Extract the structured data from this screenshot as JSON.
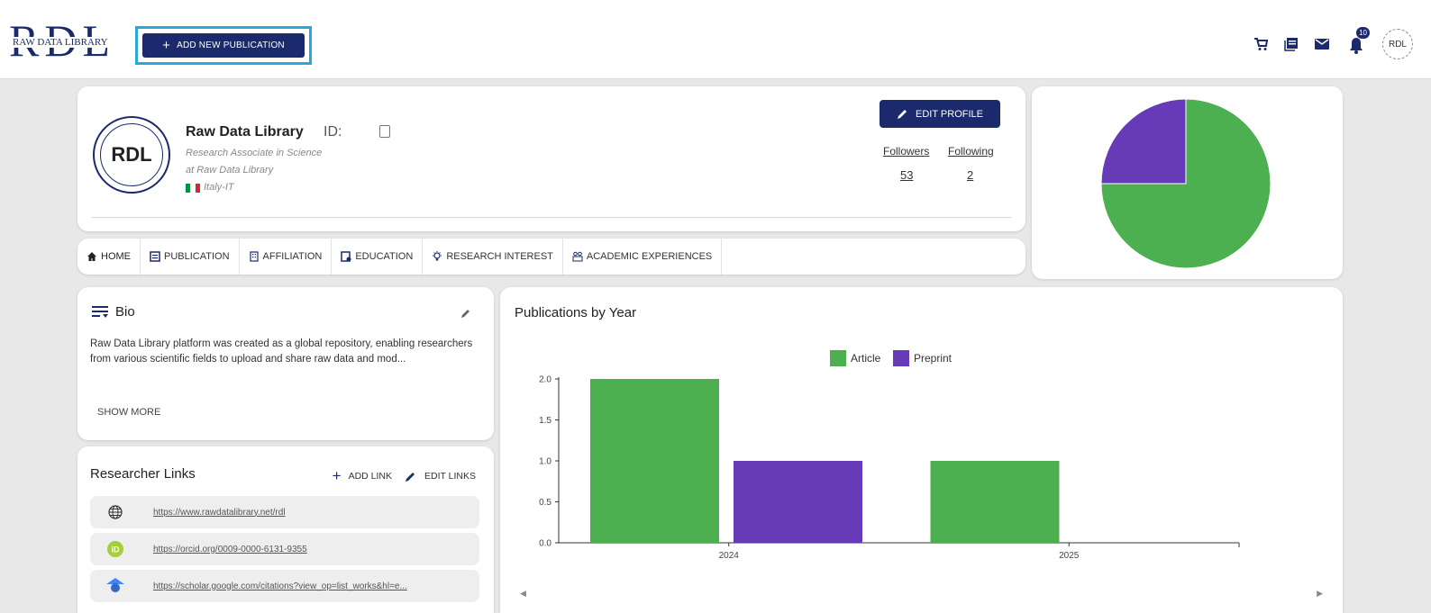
{
  "header": {
    "logo_letters": "RDL",
    "logo_subtitle": "RAW DATA LIBRARY",
    "add_publication_label": "ADD NEW PUBLICATION",
    "notification_count": "10",
    "avatar_text": "RDL",
    "icons": [
      "cart-icon",
      "library-icon",
      "mail-icon",
      "bell-icon"
    ]
  },
  "profile": {
    "avatar_text": "RDL",
    "name": "Raw Data Library",
    "id_label": "ID:",
    "role": "Research Associate in Science",
    "affiliation": "at Raw Data Library",
    "country": "Italy-IT",
    "edit_label": "EDIT PROFILE",
    "followers_label": "Followers",
    "followers_count": "53",
    "following_label": "Following",
    "following_count": "2"
  },
  "tabs": [
    {
      "label": "HOME",
      "icon": "home-icon"
    },
    {
      "label": "PUBLICATION",
      "icon": "publication-icon"
    },
    {
      "label": "AFFILIATION",
      "icon": "building-icon"
    },
    {
      "label": "EDUCATION",
      "icon": "education-icon"
    },
    {
      "label": "RESEARCH INTEREST",
      "icon": "lightbulb-icon"
    },
    {
      "label": "ACADEMIC EXPERIENCES",
      "icon": "group-icon"
    }
  ],
  "bio": {
    "title": "Bio",
    "text": "Raw Data Library platform was created as a global repository, enabling researchers from various scientific fields to upload and share raw data and mod...",
    "show_more": "SHOW MORE"
  },
  "links": {
    "title": "Researcher Links",
    "add_label": "ADD LINK",
    "edit_label": "EDIT LINKS",
    "items": [
      {
        "url": "https://www.rawdatalibrary.net/rdl",
        "icon": "globe-icon"
      },
      {
        "url": "https://orcid.org/0009-0000-6131-9355",
        "icon": "orcid-icon"
      },
      {
        "url": "https://scholar.google.com/citations?view_op=list_works&hl=e...",
        "icon": "scholar-icon"
      }
    ]
  },
  "colors": {
    "brand": "#1a2a6c",
    "article": "#4caf50",
    "preprint": "#673ab7",
    "highlight": "#29a8e0"
  },
  "chart_data": [
    {
      "type": "pie",
      "labels": [
        "Article",
        "Preprint"
      ],
      "values": [
        3,
        1
      ]
    },
    {
      "type": "bar",
      "title": "Publications by Year",
      "categories": [
        "2024",
        "2025"
      ],
      "series": [
        {
          "name": "Article",
          "values": [
            2,
            1
          ]
        },
        {
          "name": "Preprint",
          "values": [
            1,
            0
          ]
        }
      ],
      "ylim": [
        0,
        2
      ],
      "yticks": [
        "0.0",
        "0.5",
        "1.0",
        "1.5",
        "2.0"
      ],
      "legend": "top-center"
    }
  ]
}
